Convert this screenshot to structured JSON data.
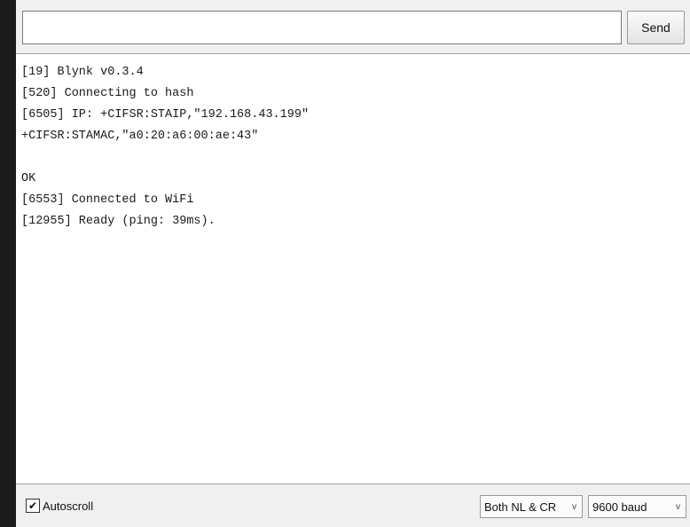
{
  "send_bar": {
    "input_value": "",
    "send_label": "Send"
  },
  "console": {
    "lines": [
      "[19] Blynk v0.3.4",
      "[520] Connecting to hash",
      "[6505] IP: +CIFSR:STAIP,\"192.168.43.199\"",
      "+CIFSR:STAMAC,\"a0:20:a6:00:ae:43\"",
      "",
      "OK",
      "[6553] Connected to WiFi",
      "[12955] Ready (ping: 39ms)."
    ]
  },
  "footer": {
    "autoscroll_label": "Autoscroll",
    "autoscroll_checked": true,
    "check_glyph": "✔",
    "line_ending": "Both NL & CR",
    "baud_rate": "9600 baud",
    "chevron_glyph": "v"
  }
}
